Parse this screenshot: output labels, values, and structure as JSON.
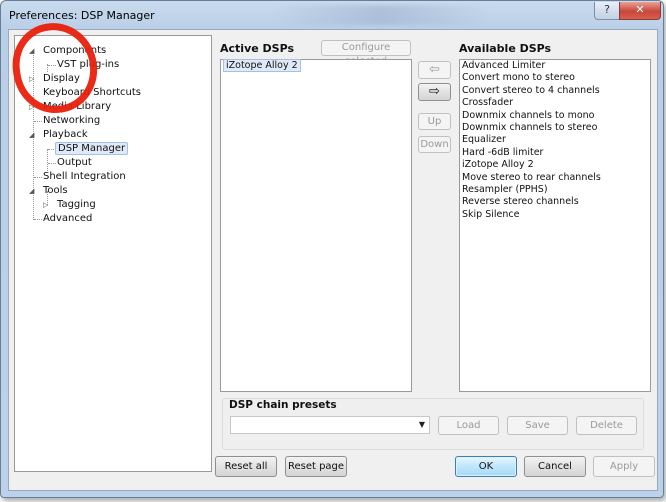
{
  "window": {
    "title": "Preferences: DSP Manager",
    "help_button": "?",
    "close_button": "✕"
  },
  "tree": {
    "items": [
      {
        "label": "Components",
        "expander": "expanded"
      },
      {
        "label": "VST plug-ins",
        "expander": ""
      },
      {
        "label": "Display",
        "expander": "collapsed"
      },
      {
        "label": "Keyboard Shortcuts",
        "expander": ""
      },
      {
        "label": "Media Library",
        "expander": "collapsed"
      },
      {
        "label": "Networking",
        "expander": ""
      },
      {
        "label": "Playback",
        "expander": "expanded"
      },
      {
        "label": "DSP Manager",
        "expander": "",
        "selected": true
      },
      {
        "label": "Output",
        "expander": ""
      },
      {
        "label": "Shell Integration",
        "expander": ""
      },
      {
        "label": "Tools",
        "expander": "expanded"
      },
      {
        "label": "Tagging",
        "expander": "collapsed"
      },
      {
        "label": "Advanced",
        "expander": ""
      }
    ],
    "expanded_glyph": "◢",
    "collapsed_glyph": "▷"
  },
  "active_dsps": {
    "title": "Active DSPs",
    "configure_button": "Configure selected",
    "items": [
      "iZotope Alloy 2"
    ]
  },
  "available_dsps": {
    "title": "Available DSPs",
    "items": [
      "Advanced Limiter",
      "Convert mono to stereo",
      "Convert stereo to 4 channels",
      "Crossfader",
      "Downmix channels to mono",
      "Downmix channels to stereo",
      "Equalizer",
      "Hard -6dB limiter",
      "iZotope Alloy 2",
      "Move stereo to rear channels",
      "Resampler (PPHS)",
      "Reverse stereo channels",
      "Skip Silence"
    ]
  },
  "move_buttons": {
    "add_arrow": "⇦",
    "remove_arrow": "⇨",
    "up": "Up",
    "down": "Down"
  },
  "presets": {
    "title": "DSP chain presets",
    "combo_value": "",
    "combo_arrow": "▼",
    "load": "Load",
    "save": "Save",
    "delete": "Delete"
  },
  "footer": {
    "reset_all": "Reset all",
    "reset_page": "Reset page",
    "ok": "OK",
    "cancel": "Cancel",
    "apply": "Apply"
  },
  "annotation": {
    "color": "#e8200c",
    "shape": "hand-drawn circle around Components / VST plug-ins"
  }
}
